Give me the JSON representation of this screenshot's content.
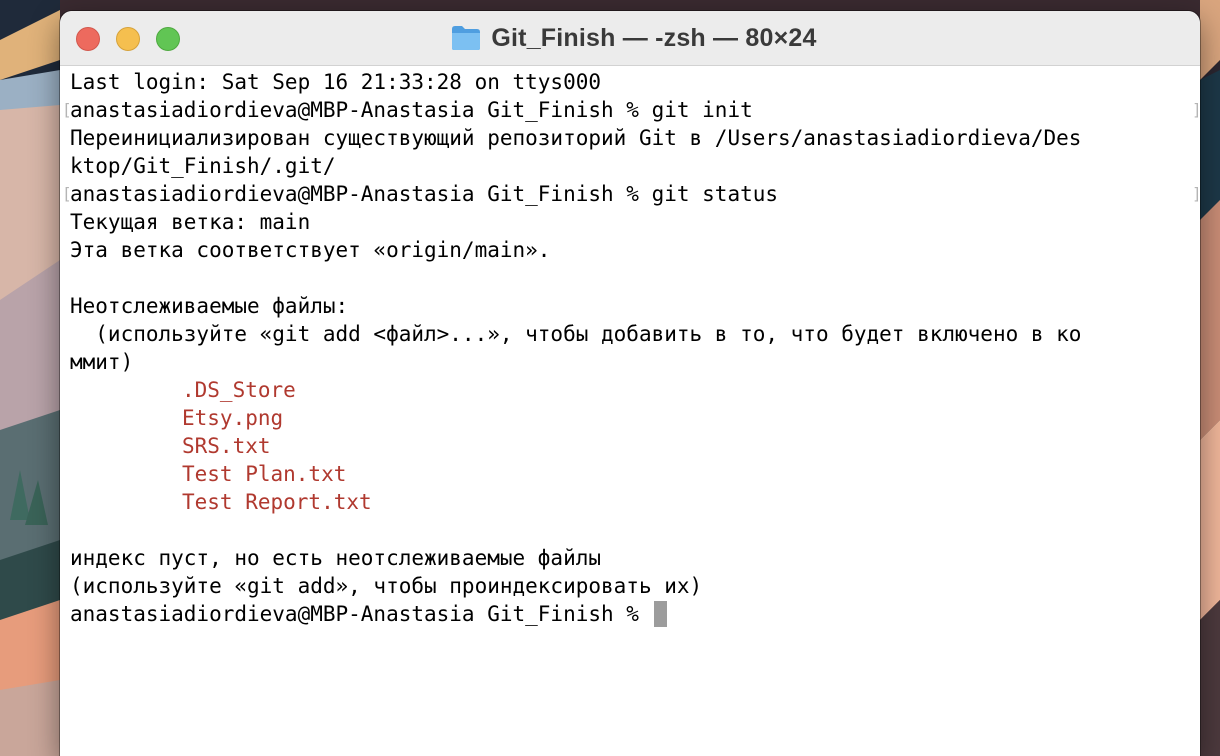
{
  "window": {
    "title": "Git_Finish — -zsh — 80×24",
    "folder_icon": "folder-icon",
    "accent_folder_color": "#5ba9e8"
  },
  "terminal": {
    "last_login": "Last login: Sat Sep 16 21:33:28 on ttys000",
    "cmd_init": "anastasiadiordieva@MBP-Anastasia Git_Finish % git init",
    "reinit_line1": "Переинициализирован существующий репозиторий Git в /Users/anastasiadiordieva/Des",
    "reinit_line2": "ktop/Git_Finish/.git/",
    "cmd_status": "anastasiadiordieva@MBP-Anastasia Git_Finish % git status",
    "branch": "Текущая ветка: main",
    "branch_tracking": "Эта ветка соответствует «origin/main».",
    "untracked_header": "Неотслеживаемые файлы:",
    "untracked_hint_line1": "  (используйте «git add <файл>...», чтобы добавить в то, что будет включено в ко",
    "untracked_hint_line2": "ммит)",
    "untracked_files": [
      ".DS_Store",
      "Etsy.png",
      "SRS.txt",
      "Test Plan.txt",
      "Test Report.txt"
    ],
    "index_empty": "индекс пуст, но есть неотслеживаемые файлы",
    "index_hint": "(используйте «git add», чтобы проиндексировать их)",
    "prompt": "anastasiadiordieva@MBP-Anastasia Git_Finish % ",
    "untracked_color": "#b0392f",
    "text_color": "#000000"
  }
}
